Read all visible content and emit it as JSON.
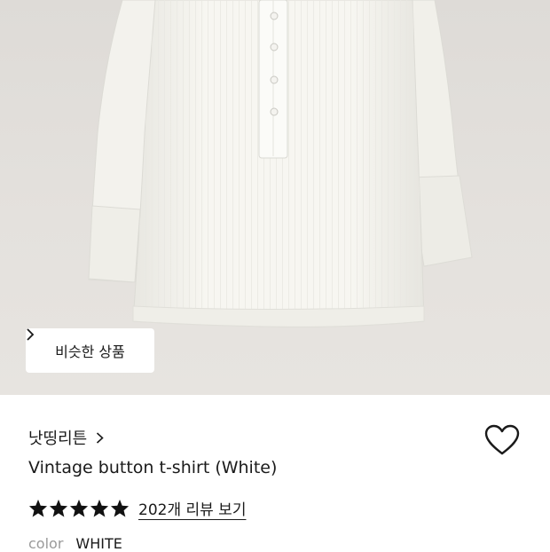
{
  "hero": {
    "image_alt": "white vintage henley button t-shirt",
    "similar_button_label": "비슷한 상품"
  },
  "product": {
    "brand": "낫띵리튼",
    "title": "Vintage button t-shirt (White)",
    "rating_stars": 5,
    "reviews_label": "202개 리뷰 보기",
    "color_label": "color",
    "color_value": "WHITE"
  },
  "colors": {
    "hero_bg": "#e2dfdb",
    "shirt": "#f6f5f0",
    "text": "#1a1a1a",
    "muted": "#9a9a9a"
  },
  "icons": {
    "favorite": "heart-icon",
    "chevron": "chevron-right-icon",
    "rating": "star-icon"
  }
}
